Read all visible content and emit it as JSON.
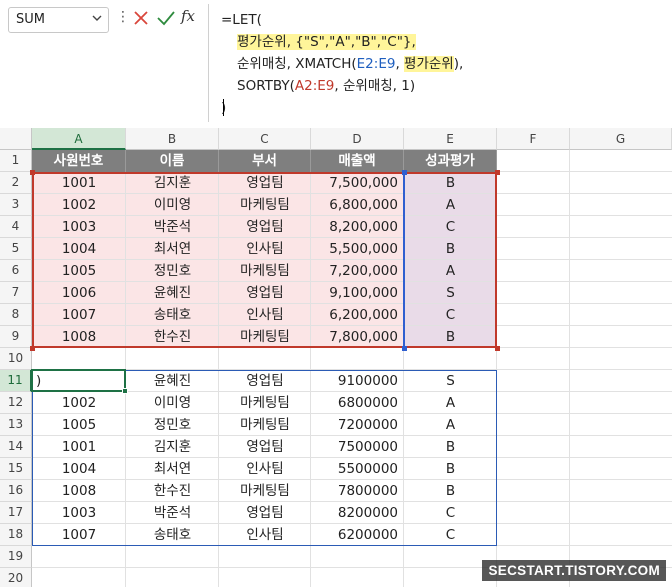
{
  "namebox": {
    "value": "SUM"
  },
  "formula_bar": {
    "fx_label": "fx",
    "lines": [
      [
        {
          "t": "=LET("
        }
      ],
      [
        {
          "t": "평가순위",
          "c": "hl"
        },
        {
          "t": ", {\"S\",\"A\",\"B\",\"C\"},",
          "c": "hl2"
        }
      ],
      [
        {
          "t": "순위매칭, XMATCH("
        },
        {
          "t": "E2:E9",
          "c": "ref-blue"
        },
        {
          "t": ", "
        },
        {
          "t": "평가순위",
          "c": "hl"
        },
        {
          "t": "),"
        }
      ],
      [
        {
          "t": "SORTBY("
        },
        {
          "t": "A2:E9",
          "c": "ref-red"
        },
        {
          "t": ", 순위매칭, 1)"
        }
      ],
      [
        {
          "t": ")"
        }
      ]
    ]
  },
  "columns": [
    "A",
    "B",
    "C",
    "D",
    "E",
    "F",
    "G"
  ],
  "rows": [
    "1",
    "2",
    "3",
    "4",
    "5",
    "6",
    "7",
    "8",
    "9",
    "10",
    "11",
    "12",
    "13",
    "14",
    "15",
    "16",
    "17",
    "18",
    "19",
    "20"
  ],
  "table_header": [
    "사원번호",
    "이름",
    "부서",
    "매출액",
    "성과평가"
  ],
  "source_rows": [
    [
      "1001",
      "김지훈",
      "영업팀",
      "7,500,000",
      "B"
    ],
    [
      "1002",
      "이미영",
      "마케팅팀",
      "6,800,000",
      "A"
    ],
    [
      "1003",
      "박준석",
      "영업팀",
      "8,200,000",
      "C"
    ],
    [
      "1004",
      "최서연",
      "인사팀",
      "5,500,000",
      "B"
    ],
    [
      "1005",
      "정민호",
      "마케팅팀",
      "7,200,000",
      "A"
    ],
    [
      "1006",
      "윤혜진",
      "영업팀",
      "9,100,000",
      "S"
    ],
    [
      "1007",
      "송태호",
      "인사팀",
      "6,200,000",
      "C"
    ],
    [
      "1008",
      "한수진",
      "마케팅팀",
      "7,800,000",
      "B"
    ]
  ],
  "result_rows": [
    [
      ")",
      "윤혜진",
      "영업팀",
      "9100000",
      "S"
    ],
    [
      "1002",
      "이미영",
      "마케팅팀",
      "6800000",
      "A"
    ],
    [
      "1005",
      "정민호",
      "마케팅팀",
      "7200000",
      "A"
    ],
    [
      "1001",
      "김지훈",
      "영업팀",
      "7500000",
      "B"
    ],
    [
      "1004",
      "최서연",
      "인사팀",
      "5500000",
      "B"
    ],
    [
      "1008",
      "한수진",
      "마케팅팀",
      "7800000",
      "B"
    ],
    [
      "1003",
      "박준석",
      "영업팀",
      "8200000",
      "C"
    ],
    [
      "1007",
      "송태호",
      "인사팀",
      "6200000",
      "C"
    ]
  ],
  "colors": {
    "accent_green": "#1e7145",
    "range_red": "#c0392b",
    "range_blue": "#2f5fd0",
    "result_blue": "#2b5bb5"
  },
  "watermark": "SECSTART.TISTORY.COM"
}
